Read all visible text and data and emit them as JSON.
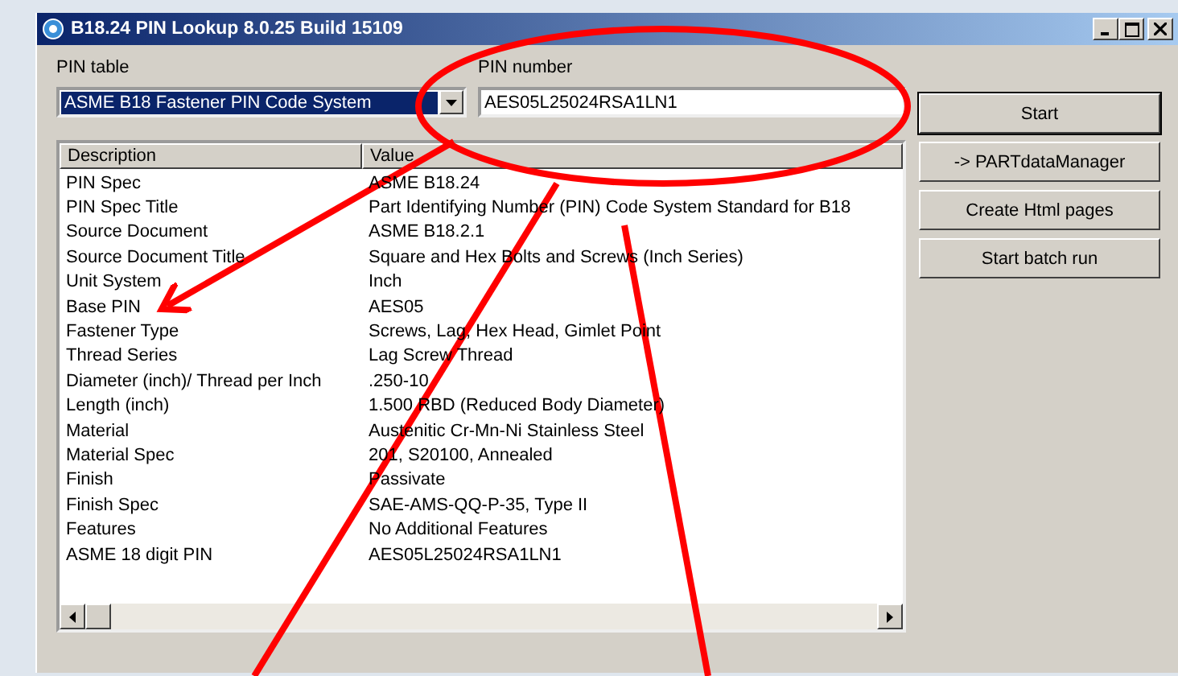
{
  "window": {
    "title": "B18.24 PIN Lookup 8.0.25 Build 15109"
  },
  "pin_table": {
    "label": "PIN table",
    "value": "ASME B18 Fastener PIN Code System",
    "selected": true
  },
  "pin_number": {
    "label": "PIN number",
    "value": "AES05L25024RSA1LN1"
  },
  "buttons": [
    "Start",
    "-> PARTdataManager",
    "Create Html pages",
    "Start batch run"
  ],
  "table": {
    "columns": [
      "Description",
      "Value"
    ],
    "rows": [
      {
        "description": "PIN Spec",
        "value": "ASME B18.24"
      },
      {
        "description": "PIN Spec Title",
        "value": "Part Identifying Number (PIN) Code System Standard for B18"
      },
      {
        "description": "Source Document",
        "value": "ASME B18.2.1"
      },
      {
        "description": "Source Document Title",
        "value": "Square and Hex Bolts and Screws (Inch Series)"
      },
      {
        "description": "Unit System",
        "value": "Inch"
      },
      {
        "description": "Base PIN",
        "value": "AES05"
      },
      {
        "description": "Fastener Type",
        "value": "Screws, Lag, Hex Head, Gimlet Point"
      },
      {
        "description": "Thread Series",
        "value": "Lag Screw Thread"
      },
      {
        "description": "Diameter (inch)/ Thread per Inch",
        "value": ".250-10"
      },
      {
        "description": "Length (inch)",
        "value": "1.500 RBD (Reduced Body Diameter)"
      },
      {
        "description": "Material",
        "value": "Austenitic Cr-Mn-Ni Stainless Steel"
      },
      {
        "description": "Material Spec",
        "value": "201, S20100, Annealed"
      },
      {
        "description": "Finish",
        "value": "Passivate"
      },
      {
        "description": "Finish Spec",
        "value": "SAE-AMS-QQ-P-35, Type II"
      },
      {
        "description": "Features",
        "value": "No Additional Features"
      },
      {
        "description": "ASME 18 digit PIN",
        "value": "AES05L25024RSA1LN1"
      }
    ]
  },
  "annotations": [
    {
      "kind": "ellipse"
    },
    {
      "kind": "arrow"
    },
    {
      "kind": "line"
    },
    {
      "kind": "line"
    }
  ]
}
